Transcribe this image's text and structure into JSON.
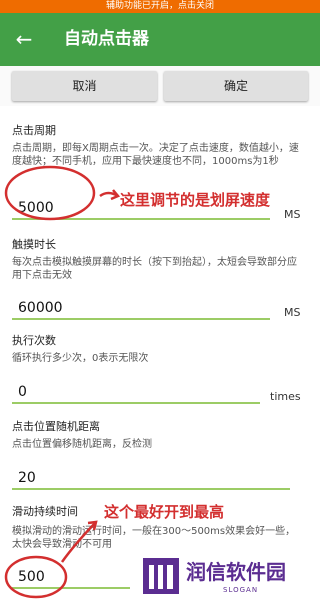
{
  "status_notice": "辅助功能已开启，点击关闭",
  "appbar": {
    "back_icon": "arrow-left-icon",
    "title": "自动点击器"
  },
  "buttons": {
    "cancel": "取消",
    "ok": "确定"
  },
  "fields": {
    "period": {
      "label": "点击周期",
      "desc": "点击周期，即每X周期点击一次。决定了点击速度，数值越小，速度越快；不同手机，应用下最快速度也不同，1000ms为1秒",
      "value": "5000",
      "unit": "MS"
    },
    "touch_duration": {
      "label": "触摸时长",
      "desc": "每次点击模拟触摸屏幕的时长（按下到抬起），太短会导致部分应用下点击无效",
      "value": "60000",
      "unit": "MS"
    },
    "repeat": {
      "label": "执行次数",
      "desc": "循环执行多少次，0表示无限次",
      "value": "0",
      "unit": "times"
    },
    "random_distance": {
      "label": "点击位置随机距离",
      "desc": "点击位置偏移随机距离，反检测",
      "value": "20"
    },
    "swipe_duration": {
      "label": "滑动持续时间",
      "desc": "模拟滑动的滑动运行时间，一般在300～500ms效果会好一些，太快会导致滑动不可用",
      "value": "500"
    }
  },
  "annotations": {
    "note1": "这里调节的是划屏速度",
    "note2": "这个最好开到最高",
    "color": "#d32f2f"
  },
  "watermark": {
    "text": "润信软件园",
    "sub": "SLOGAN",
    "color": "#5b2d91"
  },
  "colors": {
    "appbar": "#43a047",
    "notice": "#ef6c00",
    "underline": "#9ccc65"
  }
}
